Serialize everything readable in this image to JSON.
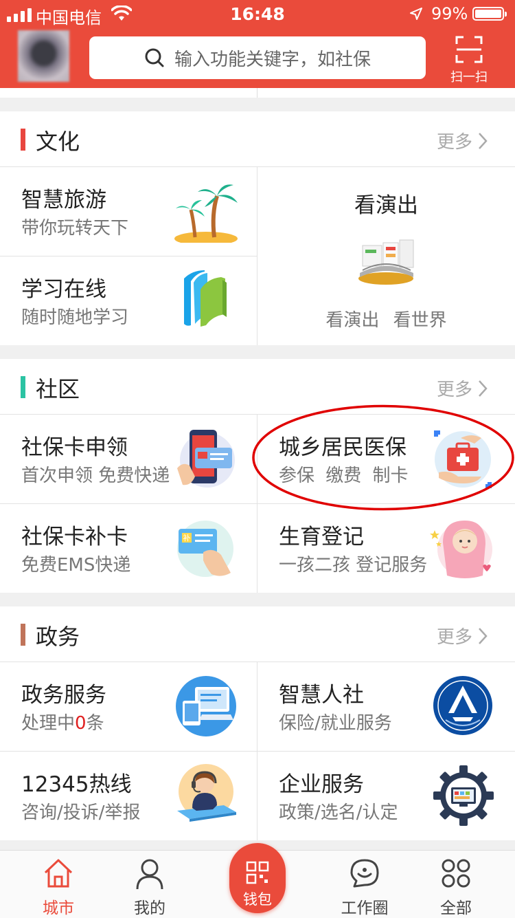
{
  "status_bar": {
    "carrier": "中国电信",
    "time": "16:48",
    "battery": "99%"
  },
  "header": {
    "search_placeholder": "输入功能关键字，如社保",
    "scan_label": "扫一扫"
  },
  "sections": {
    "culture": {
      "title": "文化",
      "more": "更多",
      "accent": "#e8463f",
      "items": [
        {
          "title": "智慧旅游",
          "subtitle": "带你玩转天下",
          "icon": "palm-beach-icon"
        },
        {
          "title": "学习在线",
          "subtitle": "随时随地学习",
          "icon": "books-icon"
        },
        {
          "title": "看演出",
          "subtitle": "看演出 看世界",
          "icon": "theater-stage-icon"
        }
      ]
    },
    "community": {
      "title": "社区",
      "more": "更多",
      "accent": "#2bc3a3",
      "items": [
        {
          "title": "社保卡申领",
          "subtitle": "首次申领 免费快递",
          "icon": "phone-card-icon"
        },
        {
          "title": "城乡居民医保",
          "subtitle": "参保 缴费 制卡",
          "icon": "medical-kit-icon"
        },
        {
          "title": "社保卡补卡",
          "subtitle": "免费EMS快递",
          "icon": "card-hand-icon"
        },
        {
          "title": "生育登记",
          "subtitle": "一孩二孩 登记服务",
          "icon": "baby-icon"
        }
      ]
    },
    "government": {
      "title": "政务",
      "more": "更多",
      "accent": "#c0745a",
      "items": [
        {
          "title": "政务服务",
          "subtitle_prefix": "处理中",
          "subtitle_count": "0",
          "subtitle_suffix": "条",
          "icon": "devices-icon"
        },
        {
          "title": "智慧人社",
          "subtitle": "保险/就业服务",
          "icon": "hrss-logo-icon"
        },
        {
          "title": "12345热线",
          "subtitle": "咨询/投诉/举报",
          "icon": "hotline-agent-icon"
        },
        {
          "title": "企业服务",
          "subtitle": "政策/选名/认定",
          "icon": "gear-screen-icon"
        }
      ]
    }
  },
  "tabbar": {
    "items": [
      {
        "label": "城市",
        "icon": "home-icon",
        "active": true
      },
      {
        "label": "我的",
        "icon": "user-icon",
        "active": false
      },
      {
        "label": "钱包",
        "icon": "qr-wallet-icon",
        "active": false
      },
      {
        "label": "工作圈",
        "icon": "chat-bubble-icon",
        "active": false
      },
      {
        "label": "全部",
        "icon": "grid-icon",
        "active": false
      }
    ]
  },
  "colors": {
    "brand": "#ea4b3b",
    "annotation": "#e00000"
  }
}
